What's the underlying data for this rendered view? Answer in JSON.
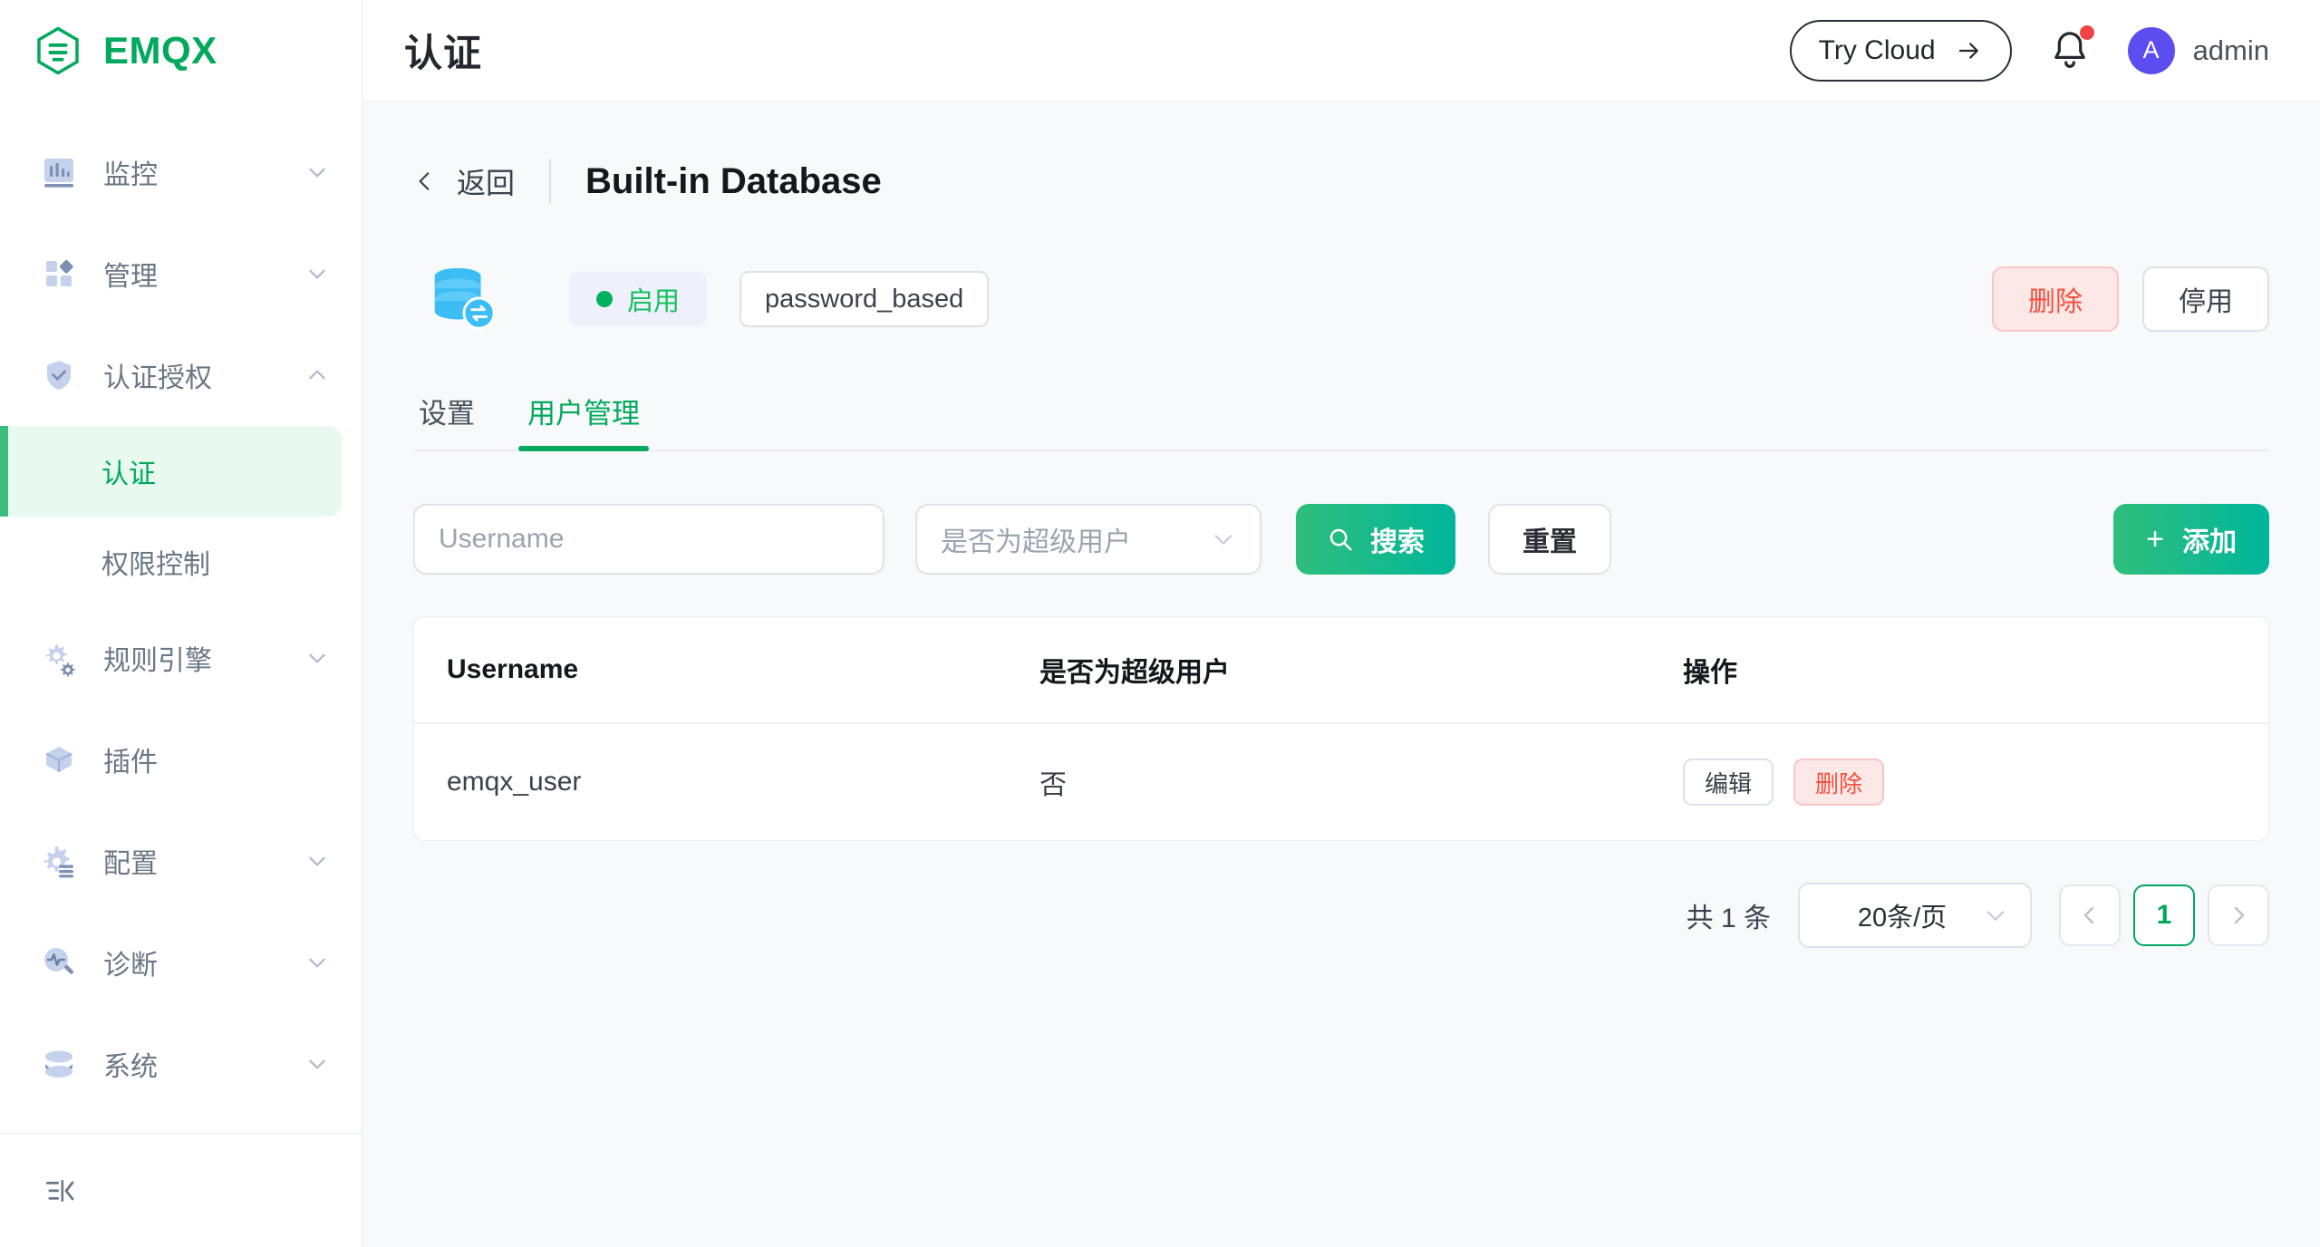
{
  "brand": {
    "name": "EMQX",
    "logo_icon": "emqx-hexagon-logo"
  },
  "sidebar": {
    "items": [
      {
        "label": "监控",
        "icon": "chart-bar-icon",
        "expandable": true,
        "expanded": false
      },
      {
        "label": "管理",
        "icon": "grid-diamond-icon",
        "expandable": true,
        "expanded": false
      },
      {
        "label": "认证授权",
        "icon": "shield-check-icon",
        "expandable": true,
        "expanded": true
      },
      {
        "label": "规则引擎",
        "icon": "gears-icon",
        "expandable": true,
        "expanded": false
      },
      {
        "label": "插件",
        "icon": "cube-icon",
        "expandable": false,
        "expanded": false
      },
      {
        "label": "配置",
        "icon": "gear-lines-icon",
        "expandable": true,
        "expanded": false
      },
      {
        "label": "诊断",
        "icon": "pulse-search-icon",
        "expandable": true,
        "expanded": false
      },
      {
        "label": "系统",
        "icon": "layers-icon",
        "expandable": true,
        "expanded": false
      }
    ],
    "submenu": [
      {
        "label": "认证",
        "active": true
      },
      {
        "label": "权限控制",
        "active": false
      }
    ],
    "collapse_icon": "collapse-sidebar-icon"
  },
  "topbar": {
    "title": "认证",
    "try_cloud_label": "Try Cloud",
    "try_cloud_icon": "arrow-right-icon",
    "bell_icon": "bell-icon",
    "has_notification": true,
    "avatar_initial": "A",
    "user_name": "admin"
  },
  "page": {
    "back_label": "返回",
    "back_icon": "chevron-left-icon",
    "title": "Built-in Database",
    "resource_icon": "database-sync-icon",
    "status_label": "启用",
    "type_tag": "password_based",
    "delete_label": "删除",
    "stop_label": "停用"
  },
  "tabs": [
    {
      "label": "设置",
      "active": false
    },
    {
      "label": "用户管理",
      "active": true
    }
  ],
  "filters": {
    "username_placeholder": "Username",
    "username_value": "",
    "superuser_placeholder": "是否为超级用户",
    "superuser_value": "",
    "search_label": "搜索",
    "search_icon": "search-icon",
    "reset_label": "重置",
    "add_label": "添加",
    "add_icon": "plus-icon"
  },
  "table": {
    "columns": [
      "Username",
      "是否为超级用户",
      "操作"
    ],
    "rows": [
      {
        "username": "emqx_user",
        "is_superuser": "否",
        "edit_label": "编辑",
        "delete_label": "删除"
      }
    ]
  },
  "pagination": {
    "total_label": "共 1 条",
    "page_size_label": "20条/页",
    "current_page": "1",
    "prev_icon": "chevron-left-icon",
    "next_icon": "chevron-right-icon",
    "caret_icon": "chevron-down-icon"
  },
  "colors": {
    "brand_green": "#00a95c",
    "accent_gradient_start": "#2fbe7c",
    "accent_gradient_end": "#00b69b",
    "danger": "#f5503d",
    "avatar_purple": "#5b4df0",
    "notification_red": "#ef4444",
    "db_icon_blue": "#3cbdf5"
  }
}
